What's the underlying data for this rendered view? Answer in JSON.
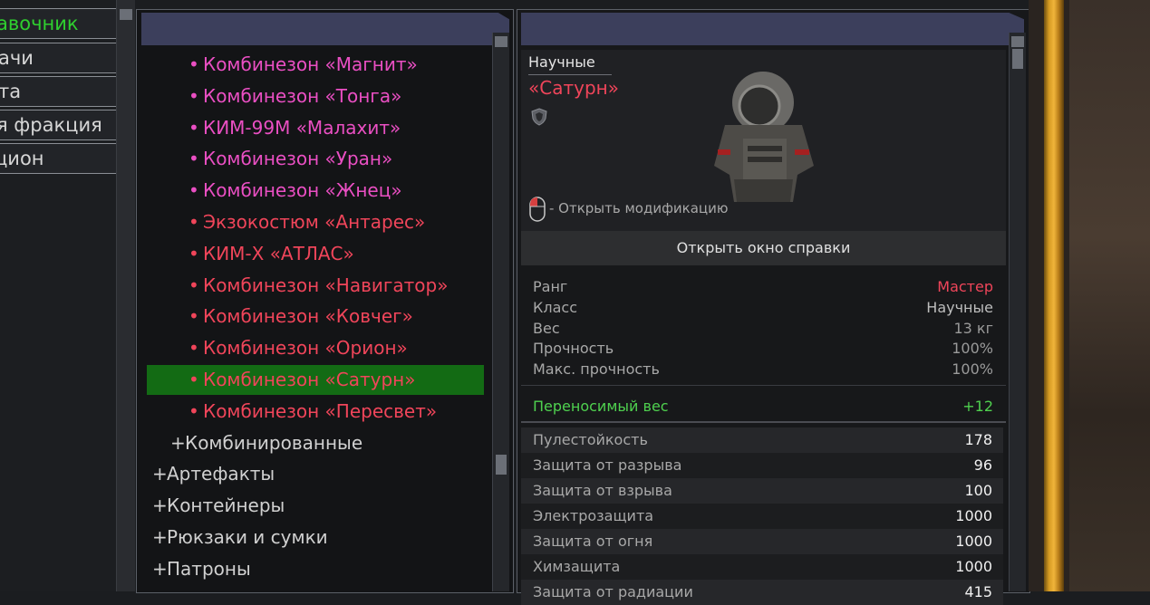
{
  "left_tabs": [
    {
      "label": "авочник",
      "color": "#2fcf2f"
    },
    {
      "label": "ачи",
      "color": "#d6d6d6"
    },
    {
      "label": "та",
      "color": "#d6d6d6"
    },
    {
      "label": "я фракция",
      "color": "#d6d6d6"
    },
    {
      "label": "цион",
      "color": "#d6d6d6"
    }
  ],
  "list": {
    "items": [
      {
        "label": "Комбинезон «Магнит»",
        "color": "#ea4fc3",
        "bullet": "•",
        "indent": "item"
      },
      {
        "label": "Комбинезон «Тонга»",
        "color": "#ea4fc3",
        "bullet": "•",
        "indent": "item"
      },
      {
        "label": "КИМ-99М «Малахит»",
        "color": "#ea4fc3",
        "bullet": "•",
        "indent": "item"
      },
      {
        "label": "Комбинезон «Уран»",
        "color": "#ea4fc3",
        "bullet": "•",
        "indent": "item"
      },
      {
        "label": "Комбинезон «Жнец»",
        "color": "#ea4fc3",
        "bullet": "•",
        "indent": "item"
      },
      {
        "label": "Экзокостюм «Антарес»",
        "color": "#f0455a",
        "bullet": "•",
        "indent": "item"
      },
      {
        "label": "КИМ-Х «АТЛАС»",
        "color": "#f0455a",
        "bullet": "•",
        "indent": "item"
      },
      {
        "label": "Комбинезон «Навигатор»",
        "color": "#f0455a",
        "bullet": "•",
        "indent": "item"
      },
      {
        "label": "Комбинезон «Ковчег»",
        "color": "#f0455a",
        "bullet": "•",
        "indent": "item"
      },
      {
        "label": "Комбинезон «Орион»",
        "color": "#f0455a",
        "bullet": "•",
        "indent": "item"
      },
      {
        "label": "Комбинезон «Сатурн»",
        "color": "#f0455a",
        "bullet": "•",
        "indent": "item",
        "selected": true
      },
      {
        "label": "Комбинезон «Пересвет»",
        "color": "#f0455a",
        "bullet": "•",
        "indent": "item"
      },
      {
        "label": "Комбинированные",
        "color": "#d0d0d0",
        "bullet": "+",
        "indent": "sub"
      },
      {
        "label": "Артефакты",
        "color": "#d0d0d0",
        "bullet": "+",
        "indent": "top"
      },
      {
        "label": "Контейнеры",
        "color": "#d0d0d0",
        "bullet": "+",
        "indent": "top"
      },
      {
        "label": "Рюкзаки и сумки",
        "color": "#d0d0d0",
        "bullet": "+",
        "indent": "top"
      },
      {
        "label": "Патроны",
        "color": "#d0d0d0",
        "bullet": "+",
        "indent": "top"
      }
    ]
  },
  "detail": {
    "category": "Научные",
    "name": "«Сатурн»",
    "name_color": "#f0455a",
    "badge_icon": "shield-icon",
    "hint": "- Открыть модификацию",
    "hint_icon": "mouse-icon",
    "help_button": "Открыть окно справки",
    "stats": [
      {
        "key": "Ранг",
        "value": "Мастер",
        "value_color": "#f0455a"
      },
      {
        "key": "Класс",
        "value": "Научные",
        "value_color": "#bdbdbd"
      },
      {
        "key": "Вес",
        "value": "13 кг",
        "value_color": "#9a9a9a"
      },
      {
        "key": "Прочность",
        "value": "100%",
        "value_color": "#9a9a9a"
      },
      {
        "key": "Макс. прочность",
        "value": "100%",
        "value_color": "#9a9a9a"
      }
    ],
    "carry": {
      "key": "Переносимый вес",
      "value": "+12",
      "color": "#4fd14f"
    },
    "protection": [
      {
        "key": "Пулестойкость",
        "value": "178"
      },
      {
        "key": "Защита от разрыва",
        "value": "96"
      },
      {
        "key": "Защита от взрыва",
        "value": "100"
      },
      {
        "key": "Электрозащита",
        "value": "1000"
      },
      {
        "key": "Защита от огня",
        "value": "1000"
      },
      {
        "key": "Химзащита",
        "value": "1000"
      },
      {
        "key": "Защита от радиации",
        "value": "415"
      }
    ]
  }
}
